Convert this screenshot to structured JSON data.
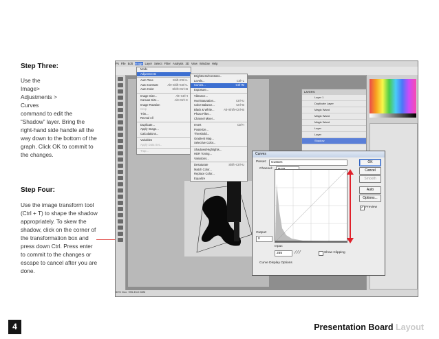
{
  "step3": {
    "title": "Step Three:",
    "body": "Use the\nImage>\n    Adjustments >\n              Curves\ncommand to edit the\n“Shadow” layer. Bring the\nright-hand side handle all the\nway down to the bottom of the\ngraph. Click OK to commit to\nthe changes."
  },
  "step4": {
    "title": "Step Four:",
    "body": "Use the image transform tool\n(Ctrl + T) to shape the shadow\nappropriately. To skew the\nshadow, click on the corner of\nthe transformation box and\npress down Ctrl. Press enter\nto commit to the changes or\nescape to cancel after you are\ndone."
  },
  "footer": {
    "page_number": "4",
    "title_main": "Presentation Board",
    "title_accent": "Layout"
  },
  "screenshot": {
    "menubar": [
      "Ps",
      "File",
      "Edit",
      "Image",
      "Layer",
      "Select",
      "Filter",
      "Analysis",
      "3D",
      "View",
      "Window",
      "Help"
    ],
    "image_menu": {
      "items": [
        {
          "label": "Mode",
          "kb": ""
        },
        {
          "label": "Adjustments",
          "kb": "",
          "hl": true
        },
        {
          "sep": true
        },
        {
          "label": "Auto Tone",
          "kb": "Shift+Ctrl+L"
        },
        {
          "label": "Auto Contrast",
          "kb": "Alt+Shift+Ctrl+L"
        },
        {
          "label": "Auto Color",
          "kb": "Shift+Ctrl+B"
        },
        {
          "sep": true
        },
        {
          "label": "Image Size...",
          "kb": "Alt+Ctrl+I"
        },
        {
          "label": "Canvas Size...",
          "kb": "Alt+Ctrl+C"
        },
        {
          "label": "Image Rotation",
          "kb": ""
        },
        {
          "label": "Crop",
          "kb": "",
          "dis": true
        },
        {
          "label": "Trim...",
          "kb": ""
        },
        {
          "label": "Reveal All",
          "kb": ""
        },
        {
          "sep": true
        },
        {
          "label": "Duplicate...",
          "kb": ""
        },
        {
          "label": "Apply Image...",
          "kb": ""
        },
        {
          "label": "Calculations...",
          "kb": ""
        },
        {
          "sep": true
        },
        {
          "label": "Variables",
          "kb": ""
        },
        {
          "label": "Apply Data Set...",
          "kb": "",
          "dis": true
        },
        {
          "sep": true
        },
        {
          "label": "Trap...",
          "kb": "",
          "dis": true
        }
      ]
    },
    "adjust_menu": {
      "items": [
        {
          "label": "Brightness/Contrast...",
          "kb": ""
        },
        {
          "label": "Levels...",
          "kb": "Ctrl+L"
        },
        {
          "label": "Curves...",
          "kb": "Ctrl+M",
          "hl": true
        },
        {
          "label": "Exposure...",
          "kb": ""
        },
        {
          "sep": true
        },
        {
          "label": "Vibrance...",
          "kb": ""
        },
        {
          "label": "Hue/Saturation...",
          "kb": "Ctrl+U"
        },
        {
          "label": "Color Balance...",
          "kb": "Ctrl+B"
        },
        {
          "label": "Black & White...",
          "kb": "Alt+Shift+Ctrl+B"
        },
        {
          "label": "Photo Filter...",
          "kb": ""
        },
        {
          "label": "Channel Mixer...",
          "kb": ""
        },
        {
          "sep": true
        },
        {
          "label": "Invert",
          "kb": "Ctrl+I"
        },
        {
          "label": "Posterize...",
          "kb": ""
        },
        {
          "label": "Threshold...",
          "kb": ""
        },
        {
          "label": "Gradient Map...",
          "kb": ""
        },
        {
          "label": "Selective Color...",
          "kb": ""
        },
        {
          "sep": true
        },
        {
          "label": "Shadows/Highlights...",
          "kb": ""
        },
        {
          "label": "HDR Toning...",
          "kb": ""
        },
        {
          "label": "Variations...",
          "kb": ""
        },
        {
          "sep": true
        },
        {
          "label": "Desaturate",
          "kb": "Shift+Ctrl+U"
        },
        {
          "label": "Match Color...",
          "kb": ""
        },
        {
          "label": "Replace Color...",
          "kb": ""
        },
        {
          "label": "Equalize",
          "kb": ""
        }
      ]
    },
    "layers": [
      "Layer 1",
      "Duplicate Layer",
      "Magic Wand",
      "Magic Wand",
      "Magic Wand",
      "Layer",
      "Layer",
      "Shadow"
    ],
    "curves": {
      "title": "Curves",
      "preset_label": "Preset:",
      "preset_value": "Custom",
      "channel_label": "Channel:",
      "channel_value": "RGB",
      "ok": "OK",
      "cancel": "Cancel",
      "smooth": "Smooth",
      "auto": "Auto",
      "options": "Options...",
      "preview": "Preview",
      "output_label": "Output:",
      "output_value": "0",
      "input_label": "Input:",
      "input_value": "255",
      "show_clipping": "Show Clipping",
      "display_options": "Curve Display Options"
    },
    "status": "50%   Doc: 995.4K/2.53M",
    "colors": {
      "red_arrow": "#e0202a",
      "highlight": "#3c6fd1"
    }
  }
}
